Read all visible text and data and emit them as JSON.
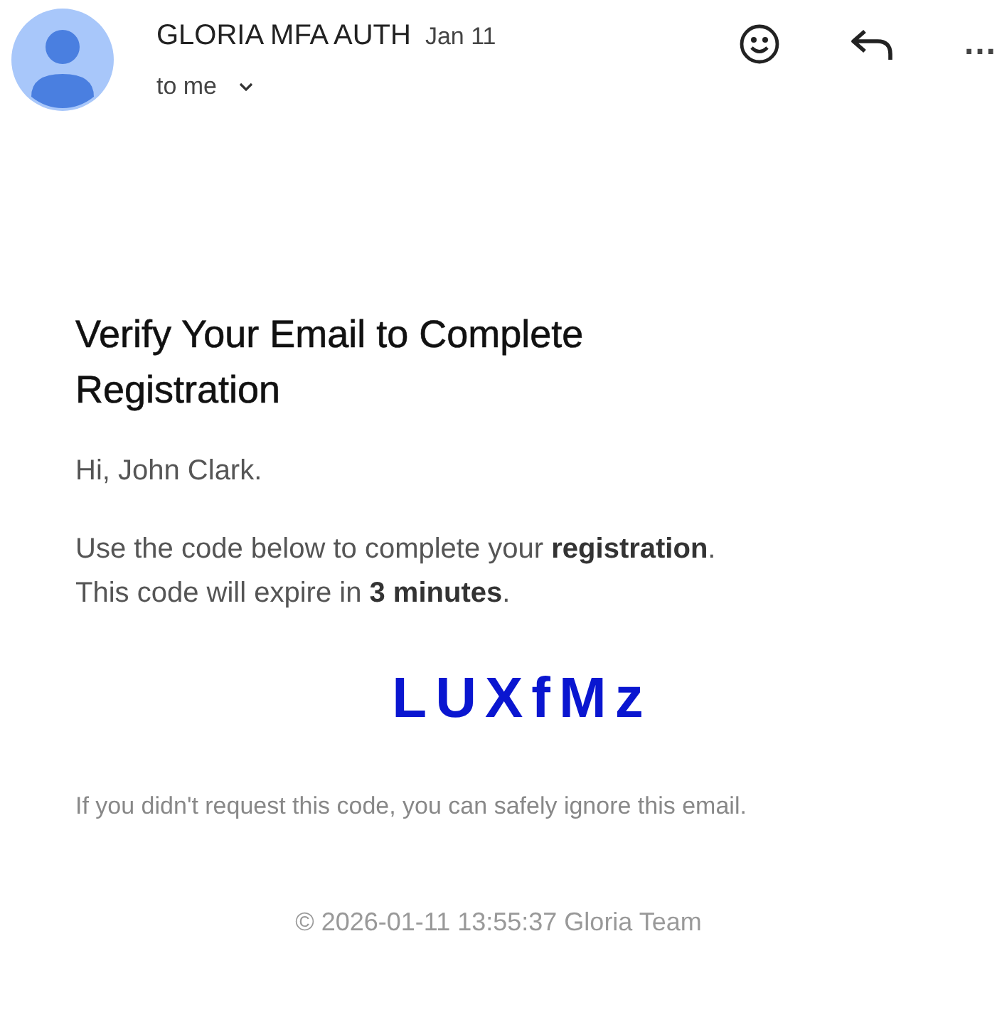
{
  "header": {
    "sender": "GLORIA MFA AUTH",
    "date": "Jan 11",
    "recipient": "to me",
    "more": "…"
  },
  "email": {
    "heading": "Verify Your Email to Complete Registration",
    "greeting": "Hi, John Clark.",
    "instructions": [
      "Use the code below to complete your **registration**.",
      "This code will expire in **3 minutes**."
    ],
    "code": "LUXfMz",
    "note": "If you didn't request this code, you can safely ignore this email.",
    "footer": "© 2026-01-11 13:55:37 Gloria Team"
  }
}
